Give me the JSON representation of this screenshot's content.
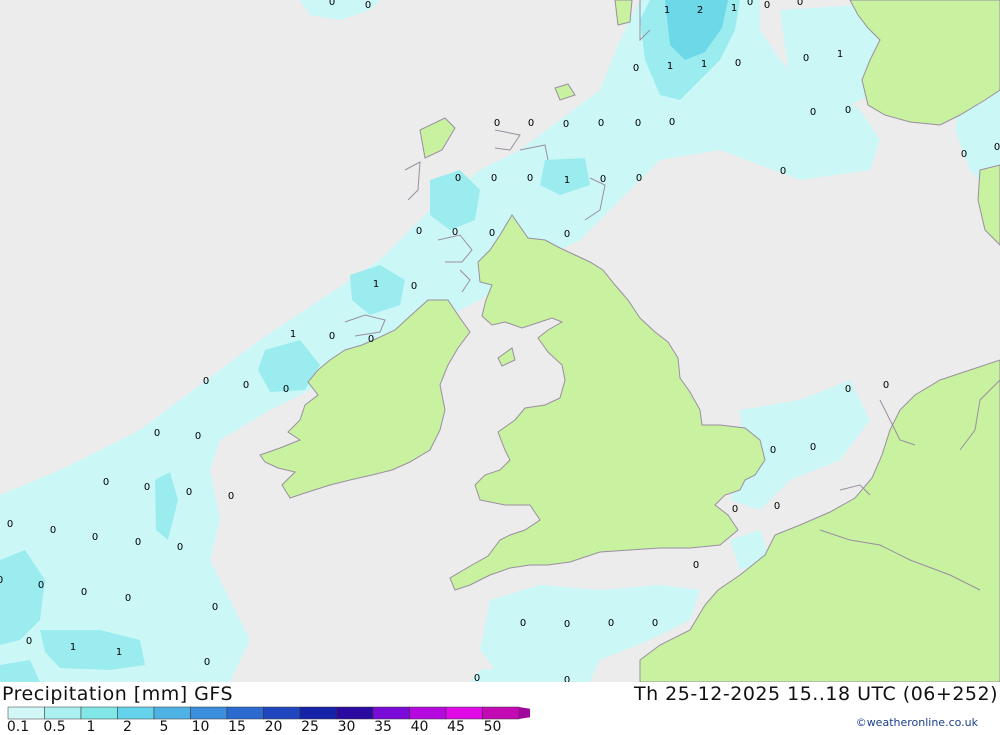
{
  "map": {
    "sea_color": "#ececec",
    "land_color": "#c8f1a0",
    "coast_color": "#9a8fa0",
    "precip_light_color": "#ccf7f7",
    "precip_mid_color": "#9becef",
    "precip_high_color": "#6dd8e8",
    "precip_values": [
      {
        "v": "1"
      },
      {
        "v": "2"
      },
      {
        "v": "1"
      },
      {
        "v": "0"
      },
      {
        "v": "0"
      },
      {
        "v": "0"
      },
      {
        "v": "0"
      },
      {
        "v": "1"
      },
      {
        "v": "1"
      },
      {
        "v": "0"
      },
      {
        "v": "0"
      },
      {
        "v": "1"
      },
      {
        "v": "0"
      },
      {
        "v": "0"
      },
      {
        "v": "0"
      },
      {
        "v": "0"
      },
      {
        "v": "0"
      },
      {
        "v": "0"
      },
      {
        "v": "0"
      },
      {
        "v": "0"
      },
      {
        "v": "1"
      },
      {
        "v": "0"
      },
      {
        "v": "0"
      },
      {
        "v": "0"
      },
      {
        "v": "0"
      },
      {
        "v": "0"
      },
      {
        "v": "1"
      },
      {
        "v": "0"
      },
      {
        "v": "0"
      },
      {
        "v": "0"
      },
      {
        "v": "0"
      },
      {
        "v": "0"
      },
      {
        "v": "0"
      },
      {
        "v": "0"
      },
      {
        "v": "1"
      },
      {
        "v": "0"
      },
      {
        "v": "0"
      },
      {
        "v": "0"
      },
      {
        "v": "0"
      },
      {
        "v": "0"
      },
      {
        "v": "0"
      },
      {
        "v": "0"
      },
      {
        "v": "0"
      },
      {
        "v": "0"
      },
      {
        "v": "0"
      },
      {
        "v": "0"
      },
      {
        "v": "0"
      },
      {
        "v": "0"
      },
      {
        "v": "0"
      },
      {
        "v": "0"
      },
      {
        "v": "0"
      },
      {
        "v": "0"
      },
      {
        "v": "0"
      },
      {
        "v": "0"
      },
      {
        "v": "0"
      },
      {
        "v": "0"
      },
      {
        "v": "0"
      },
      {
        "v": "1"
      },
      {
        "v": "1"
      },
      {
        "v": "0"
      },
      {
        "v": "0"
      },
      {
        "v": "0"
      },
      {
        "v": "0"
      },
      {
        "v": "0"
      },
      {
        "v": "0"
      },
      {
        "v": "0"
      },
      {
        "v": "0"
      },
      {
        "v": "0"
      },
      {
        "v": "0"
      },
      {
        "v": "0"
      },
      {
        "v": "0"
      },
      {
        "v": "0"
      },
      {
        "v": "0"
      },
      {
        "v": "0"
      },
      {
        "v": "0"
      },
      {
        "v": "0"
      }
    ]
  },
  "footer": {
    "title": "Precipitation [mm] GFS",
    "valid_time": "Th 25-12-2025 15..18 UTC (06+252)",
    "credit": "©weatheronline.co.uk",
    "legend": {
      "ticks": [
        "0.1",
        "0.5",
        "1",
        "2",
        "5",
        "10",
        "15",
        "20",
        "25",
        "30",
        "35",
        "40",
        "45",
        "50"
      ],
      "colors": [
        "#d2f7f7",
        "#aaf0f0",
        "#80e6e6",
        "#66d3ec",
        "#4fb2e4",
        "#3b8fdc",
        "#2d6ad0",
        "#1f46bf",
        "#1523a8",
        "#2a0aa0",
        "#7a0ad8",
        "#b40ae0",
        "#e00ae4",
        "#c40ab4",
        "#a0089c"
      ]
    }
  }
}
